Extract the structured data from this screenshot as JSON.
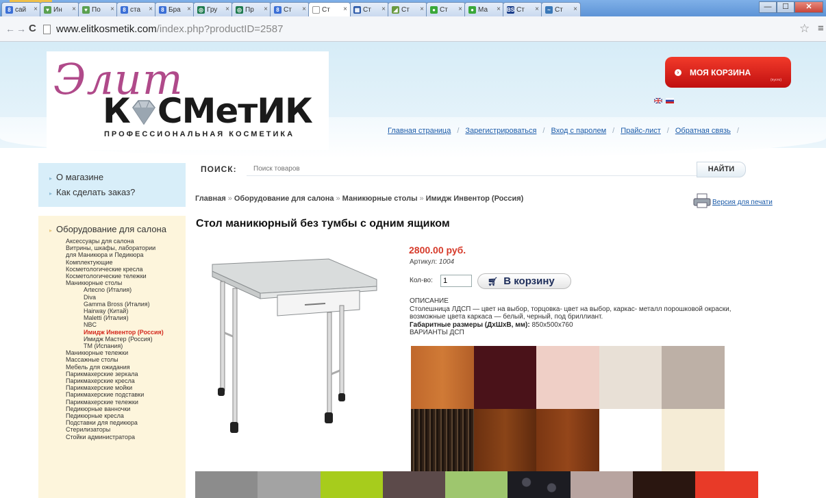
{
  "browser": {
    "tabs": [
      {
        "label": "сай",
        "fav": "#3b6fd6",
        "fav_icon": "8"
      },
      {
        "label": "Ин",
        "fav": "#5aa050",
        "fav_icon": "♥"
      },
      {
        "label": "По",
        "fav": "#5aa050",
        "fav_icon": "♥"
      },
      {
        "label": "ста",
        "fav": "#3b6fd6",
        "fav_icon": "8"
      },
      {
        "label": "Бра",
        "fav": "#3b6fd6",
        "fav_icon": "8"
      },
      {
        "label": "Гру",
        "fav": "#1e7a4e",
        "fav_icon": "◎"
      },
      {
        "label": "Пр",
        "fav": "#1e7a4e",
        "fav_icon": "◎"
      },
      {
        "label": "Ст",
        "fav": "#3b6fd6",
        "fav_icon": "8"
      },
      {
        "label": "Ст",
        "fav": "#ffffff",
        "fav_icon": "",
        "active": true
      },
      {
        "label": "Ст",
        "fav": "#2a58a8",
        "fav_icon": "▦"
      },
      {
        "label": "Ст",
        "fav": "#6a9a40",
        "fav_icon": "◢"
      },
      {
        "label": "Ст",
        "fav": "#3aa83a",
        "fav_icon": "●"
      },
      {
        "label": "Ма",
        "fav": "#3aa83a",
        "fav_icon": "●"
      },
      {
        "label": "Ст",
        "fav": "#1a3e8a",
        "fav_icon": "BS"
      },
      {
        "label": "Ст",
        "fav": "#3a78b8",
        "fav_icon": "~"
      }
    ],
    "url_host": "www.elitkosmetik.com",
    "url_path": "/index.php?productID=2587",
    "nav_back": "←",
    "nav_forward": "→",
    "reload": "C",
    "star": "☆",
    "menu": "≡",
    "win_min": "—",
    "win_max": "☐",
    "win_close": "✕"
  },
  "header": {
    "logo_script": "Элит",
    "logo_main_pre": "К",
    "logo_main_post": "СМетИК",
    "logo_sub": "ПРОФЕССИОНАЛЬНАЯ КОСМЕТИКА",
    "cart_label": "МОЯ КОРЗИНА",
    "cart_small": "(пусто)",
    "nav": [
      "Главная страница",
      "Зарегистрироваться",
      "Вход с паролем",
      "Прайс-лист",
      "Обратная связь"
    ],
    "nav_sep": "/"
  },
  "sidebar": {
    "top_links": [
      "О магазине",
      "Как сделать заказ?"
    ],
    "category_title": "Оборудование для салона",
    "items": [
      {
        "label": "Аксессуары для салона",
        "level": 2
      },
      {
        "label": "Витрины, шкафы, лаборатории",
        "level": 2
      },
      {
        "label": "для Маникюра и Педикюра",
        "level": 2
      },
      {
        "label": "Комплектующие",
        "level": 2
      },
      {
        "label": "Косметологические кресла",
        "level": 2
      },
      {
        "label": "Косметологические тележки",
        "level": 2
      },
      {
        "label": "Маникюрные столы",
        "level": 2
      },
      {
        "label": "Artecno (Италия)",
        "level": 3
      },
      {
        "label": "Diva",
        "level": 3
      },
      {
        "label": "Gamma Bross (Италия)",
        "level": 3
      },
      {
        "label": "Hairway (Китай)",
        "level": 3
      },
      {
        "label": "Maletti (Италия)",
        "level": 3
      },
      {
        "label": "NBC",
        "level": 3
      },
      {
        "label": "Имидж Инвентор (Россия)",
        "level": 3,
        "active": true
      },
      {
        "label": "Имидж Мастер (Россия)",
        "level": 3
      },
      {
        "label": "ТМ (Испания)",
        "level": 3
      },
      {
        "label": "Маникюрные тележки",
        "level": 2
      },
      {
        "label": "Массажные столы",
        "level": 2
      },
      {
        "label": "Мебель для ожидания",
        "level": 2
      },
      {
        "label": "Парикмахерские зеркала",
        "level": 2
      },
      {
        "label": "Парикмахерские кресла",
        "level": 2
      },
      {
        "label": "Парикмахерские мойки",
        "level": 2
      },
      {
        "label": "Парикмахерские подставки",
        "level": 2
      },
      {
        "label": "Парикмахерские тележки",
        "level": 2
      },
      {
        "label": "Педикюрные ванночки",
        "level": 2
      },
      {
        "label": "Педикюрные кресла",
        "level": 2
      },
      {
        "label": "Подставки для педикюра",
        "level": 2
      },
      {
        "label": "Стерилизаторы",
        "level": 2
      },
      {
        "label": "Стойки администратора",
        "level": 2
      }
    ]
  },
  "search": {
    "label": "ПОИСК:",
    "placeholder": "Поиск товаров",
    "button": "НАЙТИ"
  },
  "breadcrumb": [
    "Главная",
    "Оборудование для салона",
    "Маникюрные столы",
    "Имидж Инвентор (Россия)"
  ],
  "breadcrumb_sep": "»",
  "print_link": "Версия для печати",
  "product": {
    "title": "Стол маникюрный без тумбы с одним ящиком",
    "price": "2800.00 руб.",
    "sku_label": "Артикул:",
    "sku_value": "1004",
    "qty_label": "Кол-во:",
    "qty_value": "1",
    "add_button": "В корзину",
    "desc_heading": "ОПИСАНИЕ",
    "desc_text": "Столешница ЛДСП — цвет на выбор, торцовка- цвет на выбор, каркас- металл порошковой окраски, возможные цвета каркаса — белый, черный, под бриллиант.",
    "dims_label": "Габаритные размеры (ДхШхВ, мм):",
    "dims_value": "850x500x760",
    "variants_heading": "ВАРИАНТЫ ДСП"
  },
  "swatches_row1": [
    "#c0682c",
    "#4a1219",
    "#efcfc6",
    "#e8e0d6",
    "#bdb0a6"
  ],
  "swatches_row2": [
    "#2f2016",
    "#6a3010",
    "#7a3612",
    "#ffffff",
    "#f5ecd6"
  ],
  "swatches_row3": [
    "#8c8c8c",
    "#a3a3a3",
    "#a7cc1c",
    "#5c4a4a",
    "#9ec66e",
    "#1c1c22",
    "#b8a4a0",
    "#2a1610",
    "#e83a28"
  ]
}
